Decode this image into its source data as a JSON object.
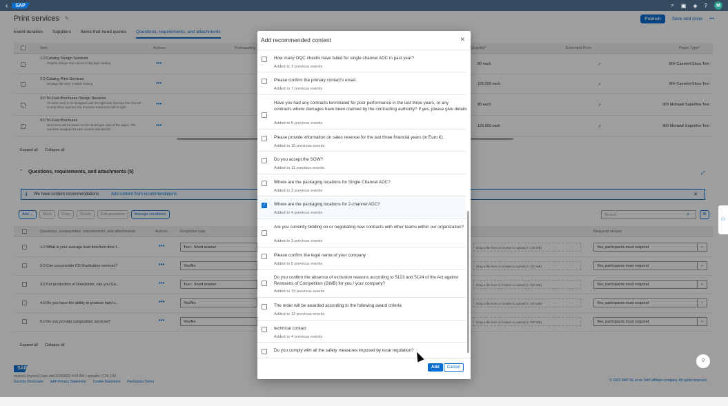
{
  "shell": {
    "logo": "SAP",
    "avatar": "M"
  },
  "header": {
    "title": "Print services",
    "publish": "Publish",
    "save_close": "Save and close",
    "more": "•••"
  },
  "tabs": [
    "Event duration",
    "Suppliers",
    "Items that need quotes",
    "Questions, requirements, and attachments"
  ],
  "items_table": {
    "headers": {
      "item": "Item",
      "actions": "Actions",
      "participating": "Participating",
      "quantity": "Quantity*",
      "extended": "Extended Price",
      "paper": "Paper Type*"
    },
    "rows": [
      {
        "name": "1.0 Catalog Design Services",
        "sub": "Graphic design and Layout of 48 page catalog",
        "each": "80 each",
        "paper": "80# Camelot Gloss Text"
      },
      {
        "name": "2.0 Catalog Print Services",
        "sub": "48 page full-color 2-sided catalog",
        "each": "125,000 each",
        "paper": "80# Camelot Gloss Text"
      },
      {
        "name": "3.0 Tri-Fold Brochures Design Services",
        "sub": "Tri-folds need to be designed with the right side first and then the left so that when opened, the brochure reads from left to right",
        "each": "80 each",
        "paper": "80# Mohawk Superfine Text"
      },
      {
        "name": "4.0 Tri-Fold Brochures",
        "sub": "Brochures will be based on the landscape view of the paper. The numbers assigned to each section indicate the",
        "each": "125,000 each",
        "paper": "80# Mohawk Superfine Text"
      }
    ],
    "expand_all": "Expand all",
    "collapse_all": "Collapse all"
  },
  "questions": {
    "section_title": "Questions, requirements, and attachments (5)",
    "message": "We have content recommendations.",
    "message_link": "Add content from recommendations",
    "toolbar": {
      "add": "Add",
      "move": "Move",
      "copy": "Copy",
      "delete": "Delete",
      "edit": "Edit questions",
      "manage": "Manage conditions"
    },
    "search_placeholder": "Search",
    "headers": {
      "q": "Questions, prerequisites, requirements, and attachments",
      "actions": "Actions",
      "response": "Response type",
      "required": "Required answer"
    },
    "rows": [
      {
        "q": "1.0 What is your average lead time/turn time f...",
        "response": "Text - Short answer",
        "drop": "Drag a file here or browse to upload (< 100 MB)",
        "req": "Yes, participants must respond"
      },
      {
        "q": "2.0 Can you provide CD Duplication services?",
        "response": "Yes/No",
        "drop": "Drag a file here or browse to upload (< 100 MB)",
        "req": "Yes, participants must respond"
      },
      {
        "q": "3.0 For production of Directories, can you Ge...",
        "response": "Text - Short answer",
        "drop": "Drag a file here or browse to upload (< 100 MB)",
        "req": "Yes, participants must respond"
      },
      {
        "q": "4.0 Do you have the ability to produce hard c...",
        "response": "Yes/No",
        "drop": "Drag a file here or browse to upload (< 100 MB)",
        "req": "Yes, participants must respond"
      },
      {
        "q": "5.0 Do you provide composition services?",
        "response": "Yes/No",
        "drop": "Drag a file here or browse to upload (< 100 MB)",
        "req": "Yes, participants must respond"
      }
    ],
    "expand_all": "Expand all",
    "collapse_all": "Collapse all"
  },
  "footer": {
    "user": "mytest1 (mytest1) last visit 3/10/2023 4:54 AM | sprealm | C34_UM",
    "links": [
      "Security Disclosure",
      "SAP Privacy Statement",
      "Cookie Statement",
      "Participant Terms"
    ],
    "copyright": "© 2022 SAP SE or an SAP affiliate company. All rights reserved."
  },
  "dialog": {
    "title": "Add recommended content",
    "items": [
      {
        "text": "How many OQC checks have failed for single channel ADC in past year?",
        "meta": "Added to 3 previous events",
        "checked": false
      },
      {
        "text": "Please confirm the primary contact's email.",
        "meta": "Added to 7 previous events",
        "checked": false
      },
      {
        "text": "Have you had any contracts terminated for poor performance in the last three years, or any contracts where damages have been claimed by the contracting authority? If yes, please give details",
        "meta": "Added to 5 previous events",
        "checked": false
      },
      {
        "text": "Please provide information on sales revenue for the last three financial years (in Euro €).",
        "meta": "Added to 15 previous events",
        "checked": false
      },
      {
        "text": "Do you accept the SOW?",
        "meta": "Added to 11 previous events",
        "checked": false
      },
      {
        "text": "Where are the packaging locations for Single Channel ADC?",
        "meta": "Added to 3 previous events",
        "checked": false
      },
      {
        "text": "Where are the packaging locations for 2-channel ADC?",
        "meta": "Added to 4 previous events",
        "checked": true
      },
      {
        "text": "Are you currently bidding on or negotiating new contracts with other teams within our organization?",
        "meta": "Added to 3 previous events",
        "checked": false
      },
      {
        "text": "Please confirm the legal name of your company",
        "meta": "Added to 5 previous events",
        "checked": false
      },
      {
        "text": "Do you confirm the absence of exclusion reasons according to 5123 and 5124 of the Act against Restraints of Competition (GWB) for you / your company?",
        "meta": "Added to 13 previous events",
        "checked": false
      },
      {
        "text": "The order will be awarded according to the following award criteria",
        "meta": "Added to 12 previous events",
        "checked": false
      },
      {
        "text": "technical contact",
        "meta": "Added to 4 previous events",
        "checked": false
      },
      {
        "text": "Do you comply with all the safety measures imposed by local regulation?",
        "meta": "",
        "checked": false
      }
    ],
    "add": "Add",
    "cancel": "Cancel"
  }
}
